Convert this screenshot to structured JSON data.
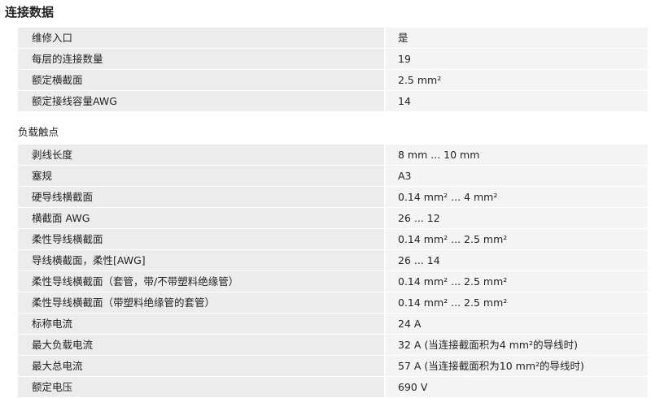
{
  "title": "连接数据",
  "connection_rows": [
    {
      "label": "维修入口",
      "value": "是"
    },
    {
      "label": "每层的连接数量",
      "value": "19"
    },
    {
      "label": "额定横截面",
      "value": "2.5 mm²"
    },
    {
      "label": "额定接线容量AWG",
      "value": "14"
    }
  ],
  "load_section": {
    "heading": "负载触点",
    "rows": [
      {
        "label": "剥线长度",
        "value": "8 mm ... 10 mm"
      },
      {
        "label": "塞规",
        "value": "A3"
      },
      {
        "label": "硬导线横截面",
        "value": "0.14 mm² ... 4 mm²"
      },
      {
        "label": "横截面 AWG",
        "value": "26 ... 12"
      },
      {
        "label": "柔性导线横截面",
        "value": "0.14 mm² ... 2.5 mm²"
      },
      {
        "label": "导线横截面，柔性[AWG]",
        "value": "26 ... 14"
      },
      {
        "label": "柔性导线横截面（套管，带/不带塑料绝缘管）",
        "value": "0.14 mm² ... 2.5 mm²"
      },
      {
        "label": "柔性导线横截面（带塑料绝缘管的套管）",
        "value": "0.14 mm² ... 2.5 mm²"
      },
      {
        "label": "标称电流",
        "value": "24 A"
      },
      {
        "label": "最大负载电流",
        "value": "32 A (当连接截面积为4 mm²的导线时)"
      },
      {
        "label": "最大总电流",
        "value": "57 A (当连接截面积为10 mm²的导线时)"
      },
      {
        "label": "额定电压",
        "value": "690 V"
      }
    ]
  }
}
